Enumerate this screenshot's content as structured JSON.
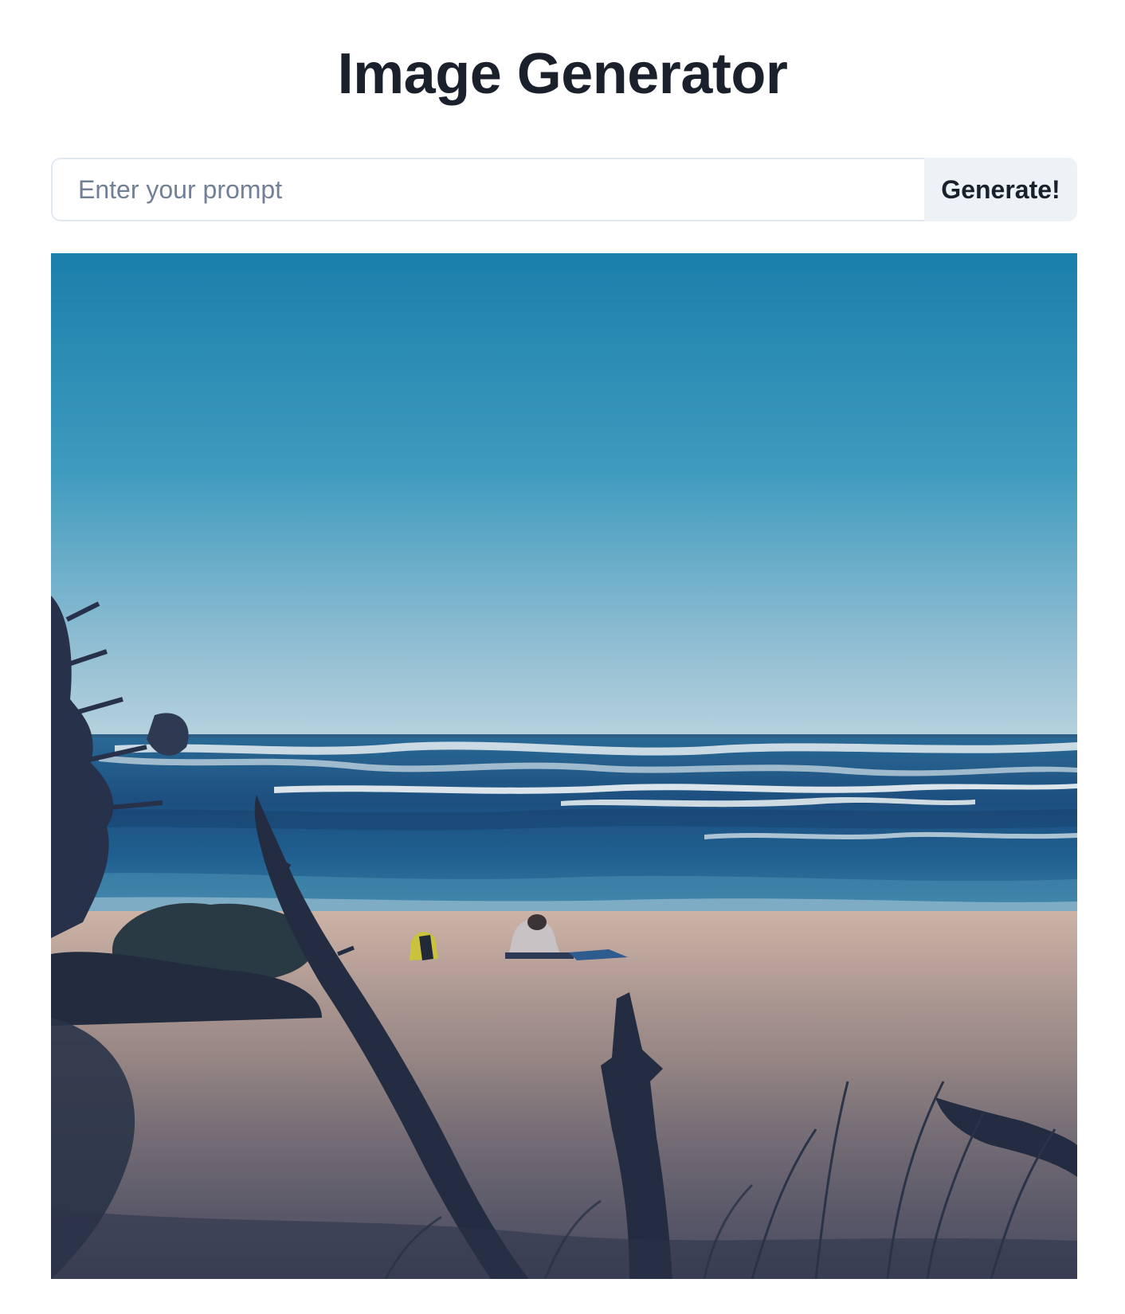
{
  "page": {
    "title": "Image Generator"
  },
  "prompt": {
    "value": "",
    "placeholder": "Enter your prompt",
    "button_label": "Generate!"
  },
  "colors": {
    "button_bg": "#edf2f7",
    "input_border": "#e2e8f0",
    "text": "#1a202c",
    "placeholder": "#718096"
  }
}
